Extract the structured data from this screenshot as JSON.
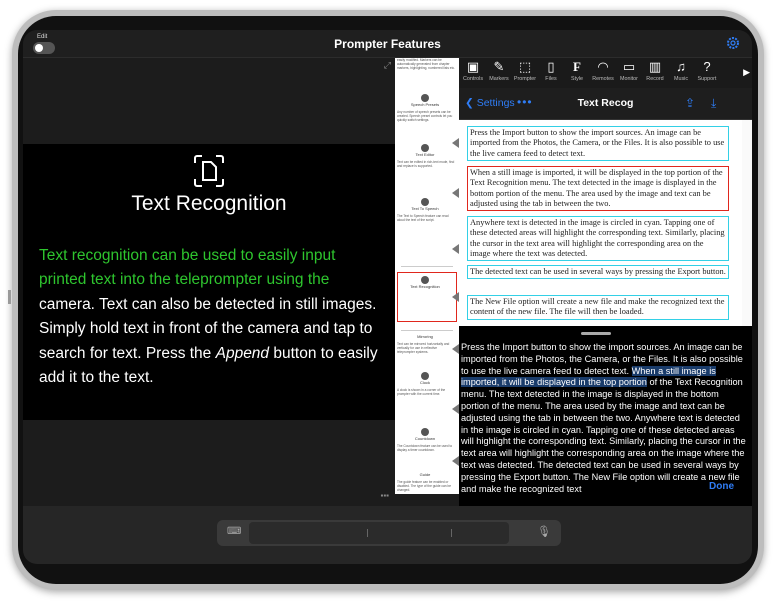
{
  "window": {
    "edit_label": "Edit",
    "title": "Prompter Features"
  },
  "preview": {
    "feature_title": "Text Recognition",
    "body_green": "Text recognition can be used to easily input printed text into the teleprompter using the",
    "body_white_1": " camera. Text can also be detected in still images. Simply hold text in front of the camera and tap to search for text. Press the ",
    "body_italic": "Append",
    "body_white_2": " button to easily add it to the text."
  },
  "thumbs": {
    "speech_presets": "Speech Presets",
    "text_editor": "Text Editor",
    "text_to_speech": "Text To Speech",
    "text_recognition": "Text Recognition",
    "mirroring": "Mirroring",
    "clock": "Clock",
    "countdown": "Countdown",
    "guide": "Guide",
    "snippet_1": "easily modified. Markers can be automatically generated from chapter markers, highlighting, numbered lists etc.",
    "snippet_2": "Any number of speech presets can be created. Speech preset controls let you quickly switch settings.",
    "snippet_3": "Text can be edited in rich-text mode, find and replace is supported.",
    "snippet_4": "The Text to Speech feature can read aloud the text of the script.",
    "snippet_5": "Text can be mirrored horizontally and vertically for use in reflective teleprompter systems.",
    "snippet_6": "A clock is shown in a corner of the prompter with the current time.",
    "snippet_7": "The Countdown feature can be used to display a timer countdown.",
    "snippet_8": "The guide feature can be enabled or disabled. The type of the guide can be changed."
  },
  "toolbar": {
    "items": [
      {
        "label": "Controls",
        "icon": "controls-icon"
      },
      {
        "label": "Markers",
        "icon": "pen-icon"
      },
      {
        "label": "Prompter",
        "icon": "prompter-icon"
      },
      {
        "label": "Files",
        "icon": "file-icon"
      },
      {
        "label": "Style",
        "icon": "font-icon"
      },
      {
        "label": "Remotes",
        "icon": "wifi-icon"
      },
      {
        "label": "Monitor",
        "icon": "monitor-icon"
      },
      {
        "label": "Record",
        "icon": "film-icon"
      },
      {
        "label": "Music",
        "icon": "music-icon"
      },
      {
        "label": "Support",
        "icon": "help-icon"
      }
    ]
  },
  "nav": {
    "back_label": "Settings",
    "title": "Text Recog"
  },
  "recognized": {
    "p1": "Press the Import button to show the import sources. An image can be imported from the Photos, the Camera, or the Files. It is also possible to use the live camera feed to detect text.",
    "p2": "When a still image is imported, it will be displayed in the top portion of the Text Recognition menu. The text detected in the image is displayed in the bottom portion of the menu. The area used by the image and text can be adjusted using the tab in between the two.",
    "p3": "Anywhere text is detected in the image is circled in cyan. Tapping one of these detected areas will highlight the corresponding text. Similarly, placing the cursor in the text area will highlight the corresponding area on the image where the text was detected.",
    "p4": "The detected text can be used in several ways by pressing the Export button.",
    "p5": "The New File option will create a new file and make the recognized text the content of the new file. The file will then be loaded."
  },
  "editor": {
    "text_a": "Press the Import button to show the import sources. An image can be imported from the Photos, the Camera, or the Files. It is also possible to use the live camera feed to detect text. ",
    "text_hl": "When a still image is imported, it will be displayed in the top portion",
    "text_b": " of the Text Recognition menu. The text detected in the image is displayed in the bottom portion of the menu. The area used by the image and text can be adjusted using the tab in between the two. Anywhere text is detected in the image is circled in cyan. Tapping one of these detected areas will highlight the corresponding text. Similarly, placing the cursor in the text area will highlight the corresponding area on the image where the text was detected. The detected text can be used in several ways by pressing the Export button. The New File option will create a new file and make the recognized text",
    "done_label": "Done"
  },
  "colors": {
    "accent": "#2f7df6",
    "green_text": "#2ec52e",
    "cyan_box": "#33d0e6",
    "red_box": "#e0271d"
  }
}
